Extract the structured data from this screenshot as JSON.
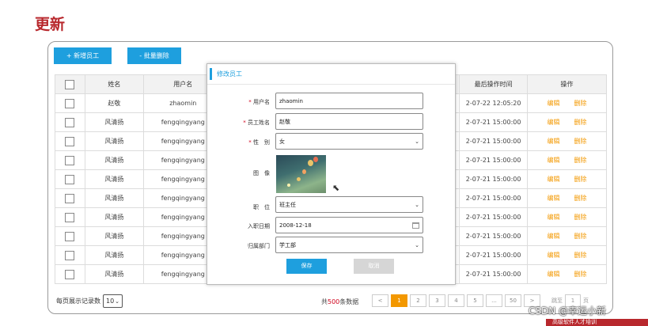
{
  "slide": {
    "title": "更新"
  },
  "toolbar": {
    "add_label": "+ 新增员工",
    "batch_delete_label": "- 批量删除"
  },
  "table": {
    "headers": [
      "",
      "姓名",
      "用户名",
      "最后操作时间",
      "操作"
    ],
    "rows": [
      {
        "name": "赵敬",
        "username": "zhaomin",
        "time": "2-07-22 12:05:20"
      },
      {
        "name": "风清扬",
        "username": "fengqingyang",
        "time": "2-07-21 15:00:00"
      },
      {
        "name": "风清扬",
        "username": "fengqingyang",
        "time": "2-07-21 15:00:00"
      },
      {
        "name": "风清扬",
        "username": "fengqingyang",
        "time": "2-07-21 15:00:00"
      },
      {
        "name": "风清扬",
        "username": "fengqingyang",
        "time": "2-07-21 15:00:00"
      },
      {
        "name": "风清扬",
        "username": "fengqingyang",
        "time": "2-07-21 15:00:00"
      },
      {
        "name": "风清扬",
        "username": "fengqingyang",
        "time": "2-07-21 15:00:00"
      },
      {
        "name": "风清扬",
        "username": "fengqingyang",
        "time": "2-07-21 15:00:00"
      },
      {
        "name": "风清扬",
        "username": "fengqingyang",
        "time": "2-07-21 15:00:00"
      },
      {
        "name": "风清扬",
        "username": "fengqingyang",
        "time": "2-07-21 15:00:00"
      }
    ],
    "edit_label": "编辑",
    "delete_label": "删除"
  },
  "footer": {
    "page_size_label": "每页展示记录数",
    "page_size_value": "10",
    "total_prefix": "共",
    "total_count": "500",
    "total_suffix": "条数据",
    "pages": [
      "<",
      "1",
      "2",
      "3",
      "4",
      "5",
      "...",
      "50",
      ">"
    ],
    "active_page": "1",
    "jump_label": "跳至",
    "jump_value": "1",
    "jump_suffix": "页"
  },
  "modal": {
    "title": "修改员工",
    "fields": {
      "username_label": "用户名",
      "username_value": "zhaomin",
      "name_label": "员工姓名",
      "name_value": "赵敬",
      "gender_label": "性　别",
      "gender_value": "女",
      "photo_label": "图　像",
      "position_label": "职　位",
      "position_value": "班主任",
      "hire_date_label": "入职日期",
      "hire_date_value": "2008-12-18",
      "dept_label": "归属部门",
      "dept_value": "学工部"
    },
    "save_label": "保存",
    "cancel_label": "取消"
  },
  "overlay": {
    "watermark": "CSDN @幸运小新",
    "banner": "高级软件人才培训"
  }
}
